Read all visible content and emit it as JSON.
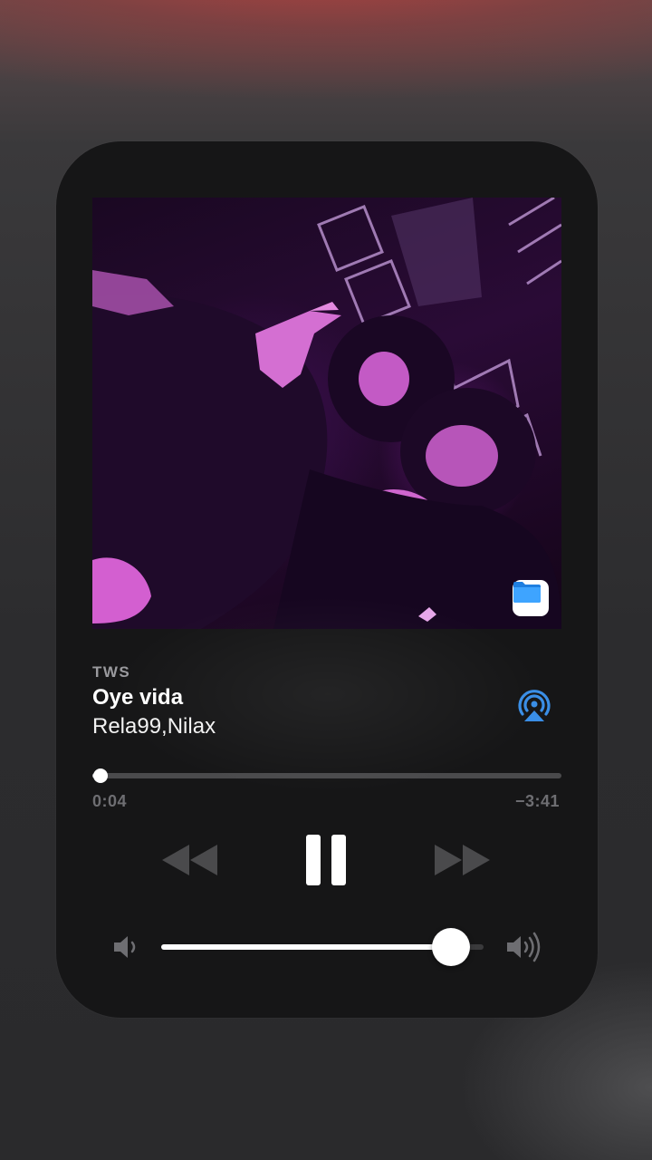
{
  "now_playing": {
    "album": "TWS",
    "title": "Oye vida",
    "artist": "Rela99,Nilax",
    "elapsed": "0:04",
    "remaining": "−3:41",
    "progress": 0.018,
    "volume": 0.9
  },
  "icons": {
    "airplay": "airplay-icon",
    "rewind": "rewind-icon",
    "pause": "pause-icon",
    "forward": "fast-forward-icon",
    "volume_low": "speaker-low-icon",
    "volume_high": "speaker-high-icon",
    "source_app": "files-app-icon"
  },
  "colors": {
    "accent": "#3a8ee6",
    "card": "#161617",
    "inactive_control": "#4a4a4c"
  }
}
